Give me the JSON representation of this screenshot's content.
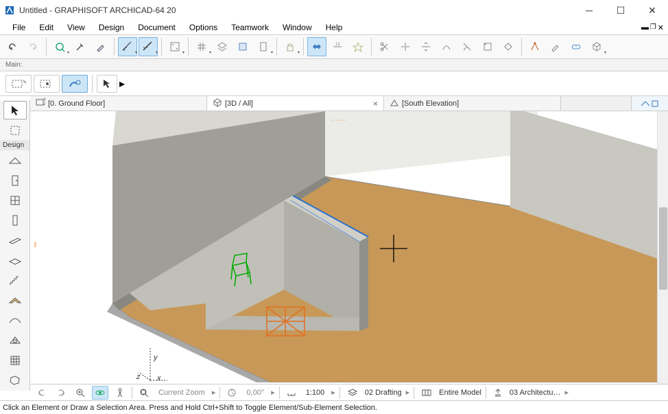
{
  "titlebar": {
    "title": "Untitled - GRAPHISOFT ARCHICAD-64 20"
  },
  "menubar": {
    "items": [
      "File",
      "Edit",
      "View",
      "Design",
      "Document",
      "Options",
      "Teamwork",
      "Window",
      "Help"
    ]
  },
  "sub_toolbar": {
    "label": "Main:"
  },
  "tabs": [
    {
      "icon": "floor",
      "label": "[0. Ground Floor]",
      "active": false,
      "closable": false
    },
    {
      "icon": "3d",
      "label": "[3D / All]",
      "active": true,
      "closable": true
    },
    {
      "icon": "elev",
      "label": "[South Elevation]",
      "active": false,
      "closable": false
    }
  ],
  "toolbox": {
    "section_label": "Design",
    "arrow_active": true
  },
  "bottom": {
    "current_zoom": "Current Zoom",
    "angle": "0,00°",
    "scale": "1:100",
    "layer_combo": "02 Drafting",
    "model_view": "Entire Model",
    "renovation": "03 Architectu…"
  },
  "statusbar": {
    "message": "Click an Element or Draw a Selection Area. Press and Hold Ctrl+Shift to Toggle Element/Sub-Element Selection."
  }
}
